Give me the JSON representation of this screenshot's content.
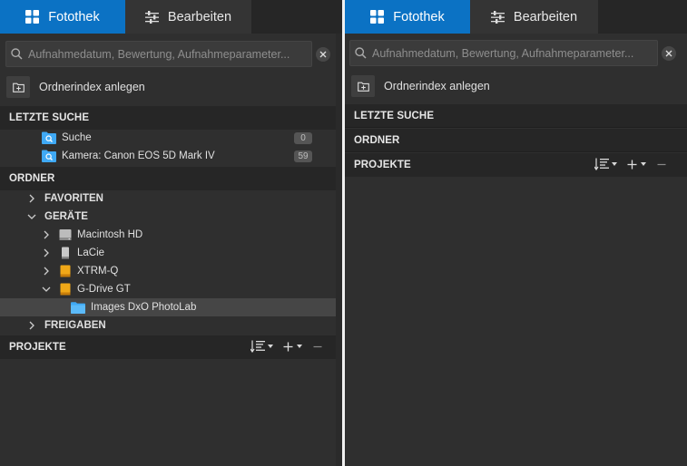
{
  "tabs": {
    "library": "Fotothek",
    "edit": "Bearbeiten"
  },
  "search": {
    "placeholder": "Aufnahmedatum, Bewertung, Aufnahmeparameter..."
  },
  "index_button_label": "Ordnerindex anlegen",
  "sections": {
    "recent_search": "LETZTE SUCHE",
    "folders": "ORDNER",
    "projects": "PROJEKTE"
  },
  "recent_searches": [
    {
      "label": "Suche",
      "count": "0"
    },
    {
      "label": "Kamera: Canon EOS 5D Mark IV",
      "count": "59"
    }
  ],
  "folders": {
    "favorites": "FAVORITEN",
    "devices": "GERÄTE",
    "drives": [
      {
        "label": "Macintosh HD",
        "icon": "internal-disk-icon"
      },
      {
        "label": "LaCie",
        "icon": "external-disk-icon"
      },
      {
        "label": "XTRM-Q",
        "icon": "usb-drive-icon"
      },
      {
        "label": "G-Drive GT",
        "icon": "usb-drive-icon"
      }
    ],
    "selected_folder": "Images DxO PhotoLab",
    "shares": "FREIGABEN"
  },
  "colors": {
    "accent": "#0b72c4",
    "folder": "#3fa9f5",
    "drive_orange": "#f0a818"
  }
}
